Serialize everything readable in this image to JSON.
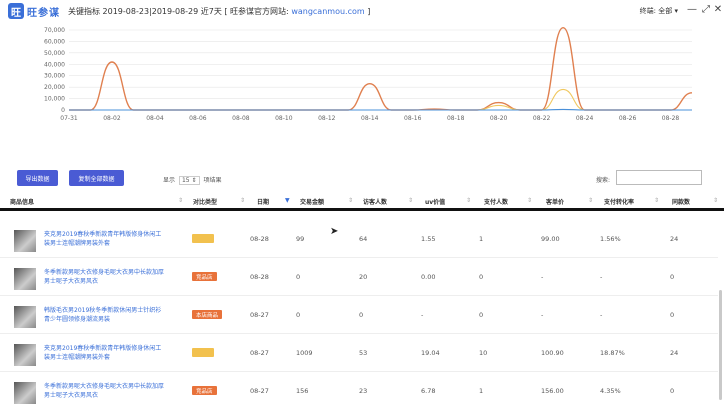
{
  "window": {
    "logo_letter": "旺",
    "app_name": "旺参谋",
    "title": "关键指标 2019-08-23|2019-08-29 近7天 [ 旺参谋官方网站:",
    "site": "wangcanmou.com",
    "title_end": "]",
    "terminal": "终端: 全部",
    "dropdown_icon": "▾",
    "minimize_icon": "—",
    "maximize_icon": "⤢",
    "close_icon": "✕"
  },
  "chart_data": {
    "type": "line",
    "x": [
      "07-31",
      "08-01",
      "08-02",
      "08-03",
      "08-04",
      "08-05",
      "08-06",
      "08-07",
      "08-08",
      "08-09",
      "08-10",
      "08-11",
      "08-12",
      "08-13",
      "08-14",
      "08-15",
      "08-16",
      "08-17",
      "08-18",
      "08-19",
      "08-20",
      "08-21",
      "08-22",
      "08-23",
      "08-24",
      "08-25",
      "08-26",
      "08-27",
      "08-28",
      "08-29"
    ],
    "x_ticks": [
      "07-31",
      "08-02",
      "08-04",
      "08-06",
      "08-08",
      "08-10",
      "08-12",
      "08-14",
      "08-16",
      "08-18",
      "08-20",
      "08-22",
      "08-24",
      "08-26",
      "08-28"
    ],
    "y_ticks": [
      "0",
      "10,000",
      "20,000",
      "30,000",
      "40,000",
      "50,000",
      "60,000",
      "70,000"
    ],
    "ylim": [
      0,
      70000
    ],
    "grid": true,
    "series": [
      {
        "color": "#e08050",
        "values": [
          0,
          0,
          42000,
          0,
          0,
          0,
          0,
          0,
          0,
          0,
          0,
          0,
          0,
          0,
          23000,
          0,
          0,
          800,
          0,
          0,
          6500,
          0,
          0,
          72000,
          0,
          0,
          0,
          0,
          0,
          15000
        ]
      },
      {
        "color": "#f0c860",
        "values": [
          0,
          0,
          0,
          0,
          0,
          0,
          0,
          0,
          0,
          0,
          0,
          0,
          0,
          0,
          0,
          0,
          0,
          0,
          0,
          0,
          4000,
          0,
          0,
          18000,
          0,
          0,
          0,
          0,
          0,
          0
        ]
      },
      {
        "color": "#4a90d9",
        "values": [
          0,
          0,
          0,
          0,
          0,
          0,
          0,
          0,
          0,
          0,
          0,
          0,
          0,
          0,
          0,
          0,
          0,
          0,
          0,
          0,
          0,
          0,
          0,
          500,
          0,
          0,
          0,
          0,
          0,
          0
        ]
      }
    ]
  },
  "toolbar": {
    "export_label": "导出数据",
    "copy_label": "复制全部数据",
    "show_label": "显示",
    "page_size": "15",
    "page_size_arrow": "⇕",
    "show_suffix": "项结果",
    "search_label": "搜索:",
    "search_value": ""
  },
  "table": {
    "headers": [
      "商品信息",
      "对比类型",
      "日期",
      "交易金额",
      "访客人数",
      "uv价值",
      "支付人数",
      "客单价",
      "支付转化率",
      "同款数"
    ],
    "sort_icon": "⇕",
    "sort_active_icon": "▼",
    "rows": [
      {
        "name": "夹克男2019春秋季新款青年韩版修身休闲工装男士连帽潮牌男装外套",
        "badge": "",
        "badge_color": "#f2c14e",
        "date": "08-28",
        "amount": "99",
        "visitors": "64",
        "uv": "1.55",
        "buyers": "1",
        "avg_price": "99.00",
        "conversion": "1.56%",
        "same": "24"
      },
      {
        "name": "冬季新款男呢大衣修身毛呢大衣男中长款加厚男士呢子大衣男风衣",
        "badge": "竞品店",
        "badge_color": "#e8723a",
        "date": "08-28",
        "amount": "0",
        "visitors": "20",
        "uv": "0.00",
        "buyers": "0",
        "avg_price": "-",
        "conversion": "-",
        "same": "0"
      },
      {
        "name": "韩版毛衣男2019秋冬季新款休闲男士针织衫青少年圆领修身潮流男装",
        "badge": "本店商品",
        "badge_color": "#e8723a",
        "date": "08-27",
        "amount": "0",
        "visitors": "0",
        "uv": "-",
        "buyers": "0",
        "avg_price": "-",
        "conversion": "-",
        "same": "0"
      },
      {
        "name": "夹克男2019春秋季新款青年韩版修身休闲工装男士连帽潮牌男装外套",
        "badge": "",
        "badge_color": "#f2c14e",
        "date": "08-27",
        "amount": "1009",
        "visitors": "53",
        "uv": "19.04",
        "buyers": "10",
        "avg_price": "100.90",
        "conversion": "18.87%",
        "same": "24"
      },
      {
        "name": "冬季新款男呢大衣修身毛呢大衣男中长款加厚男士呢子大衣男风衣",
        "badge": "竞品店",
        "badge_color": "#e8723a",
        "date": "08-27",
        "amount": "156",
        "visitors": "23",
        "uv": "6.78",
        "buyers": "1",
        "avg_price": "156.00",
        "conversion": "4.35%",
        "same": "0"
      }
    ]
  },
  "cursor_icon": "➤"
}
